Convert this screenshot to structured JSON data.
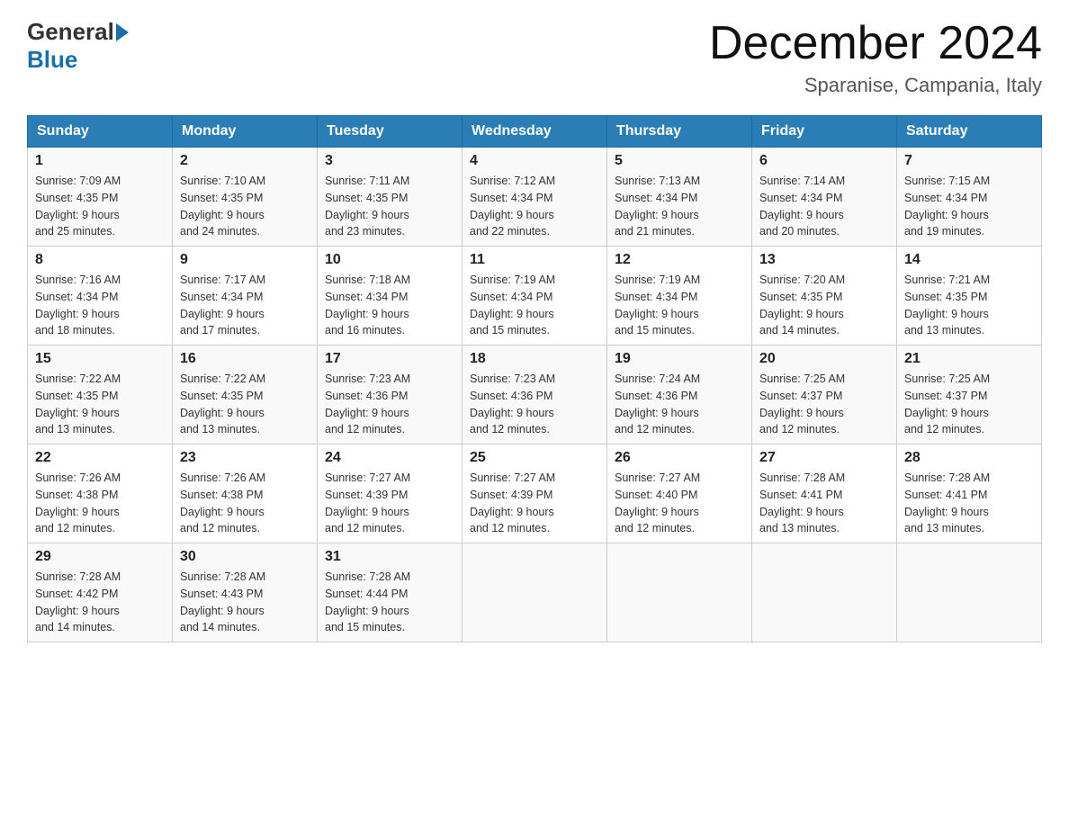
{
  "header": {
    "logo_general": "General",
    "logo_blue": "Blue",
    "month_title": "December 2024",
    "location": "Sparanise, Campania, Italy"
  },
  "days_of_week": [
    "Sunday",
    "Monday",
    "Tuesday",
    "Wednesday",
    "Thursday",
    "Friday",
    "Saturday"
  ],
  "weeks": [
    [
      {
        "day": "1",
        "sunrise": "7:09 AM",
        "sunset": "4:35 PM",
        "daylight": "9 hours and 25 minutes."
      },
      {
        "day": "2",
        "sunrise": "7:10 AM",
        "sunset": "4:35 PM",
        "daylight": "9 hours and 24 minutes."
      },
      {
        "day": "3",
        "sunrise": "7:11 AM",
        "sunset": "4:35 PM",
        "daylight": "9 hours and 23 minutes."
      },
      {
        "day": "4",
        "sunrise": "7:12 AM",
        "sunset": "4:34 PM",
        "daylight": "9 hours and 22 minutes."
      },
      {
        "day": "5",
        "sunrise": "7:13 AM",
        "sunset": "4:34 PM",
        "daylight": "9 hours and 21 minutes."
      },
      {
        "day": "6",
        "sunrise": "7:14 AM",
        "sunset": "4:34 PM",
        "daylight": "9 hours and 20 minutes."
      },
      {
        "day": "7",
        "sunrise": "7:15 AM",
        "sunset": "4:34 PM",
        "daylight": "9 hours and 19 minutes."
      }
    ],
    [
      {
        "day": "8",
        "sunrise": "7:16 AM",
        "sunset": "4:34 PM",
        "daylight": "9 hours and 18 minutes."
      },
      {
        "day": "9",
        "sunrise": "7:17 AM",
        "sunset": "4:34 PM",
        "daylight": "9 hours and 17 minutes."
      },
      {
        "day": "10",
        "sunrise": "7:18 AM",
        "sunset": "4:34 PM",
        "daylight": "9 hours and 16 minutes."
      },
      {
        "day": "11",
        "sunrise": "7:19 AM",
        "sunset": "4:34 PM",
        "daylight": "9 hours and 15 minutes."
      },
      {
        "day": "12",
        "sunrise": "7:19 AM",
        "sunset": "4:34 PM",
        "daylight": "9 hours and 15 minutes."
      },
      {
        "day": "13",
        "sunrise": "7:20 AM",
        "sunset": "4:35 PM",
        "daylight": "9 hours and 14 minutes."
      },
      {
        "day": "14",
        "sunrise": "7:21 AM",
        "sunset": "4:35 PM",
        "daylight": "9 hours and 13 minutes."
      }
    ],
    [
      {
        "day": "15",
        "sunrise": "7:22 AM",
        "sunset": "4:35 PM",
        "daylight": "9 hours and 13 minutes."
      },
      {
        "day": "16",
        "sunrise": "7:22 AM",
        "sunset": "4:35 PM",
        "daylight": "9 hours and 13 minutes."
      },
      {
        "day": "17",
        "sunrise": "7:23 AM",
        "sunset": "4:36 PM",
        "daylight": "9 hours and 12 minutes."
      },
      {
        "day": "18",
        "sunrise": "7:23 AM",
        "sunset": "4:36 PM",
        "daylight": "9 hours and 12 minutes."
      },
      {
        "day": "19",
        "sunrise": "7:24 AM",
        "sunset": "4:36 PM",
        "daylight": "9 hours and 12 minutes."
      },
      {
        "day": "20",
        "sunrise": "7:25 AM",
        "sunset": "4:37 PM",
        "daylight": "9 hours and 12 minutes."
      },
      {
        "day": "21",
        "sunrise": "7:25 AM",
        "sunset": "4:37 PM",
        "daylight": "9 hours and 12 minutes."
      }
    ],
    [
      {
        "day": "22",
        "sunrise": "7:26 AM",
        "sunset": "4:38 PM",
        "daylight": "9 hours and 12 minutes."
      },
      {
        "day": "23",
        "sunrise": "7:26 AM",
        "sunset": "4:38 PM",
        "daylight": "9 hours and 12 minutes."
      },
      {
        "day": "24",
        "sunrise": "7:27 AM",
        "sunset": "4:39 PM",
        "daylight": "9 hours and 12 minutes."
      },
      {
        "day": "25",
        "sunrise": "7:27 AM",
        "sunset": "4:39 PM",
        "daylight": "9 hours and 12 minutes."
      },
      {
        "day": "26",
        "sunrise": "7:27 AM",
        "sunset": "4:40 PM",
        "daylight": "9 hours and 12 minutes."
      },
      {
        "day": "27",
        "sunrise": "7:28 AM",
        "sunset": "4:41 PM",
        "daylight": "9 hours and 13 minutes."
      },
      {
        "day": "28",
        "sunrise": "7:28 AM",
        "sunset": "4:41 PM",
        "daylight": "9 hours and 13 minutes."
      }
    ],
    [
      {
        "day": "29",
        "sunrise": "7:28 AM",
        "sunset": "4:42 PM",
        "daylight": "9 hours and 14 minutes."
      },
      {
        "day": "30",
        "sunrise": "7:28 AM",
        "sunset": "4:43 PM",
        "daylight": "9 hours and 14 minutes."
      },
      {
        "day": "31",
        "sunrise": "7:28 AM",
        "sunset": "4:44 PM",
        "daylight": "9 hours and 15 minutes."
      },
      null,
      null,
      null,
      null
    ]
  ]
}
